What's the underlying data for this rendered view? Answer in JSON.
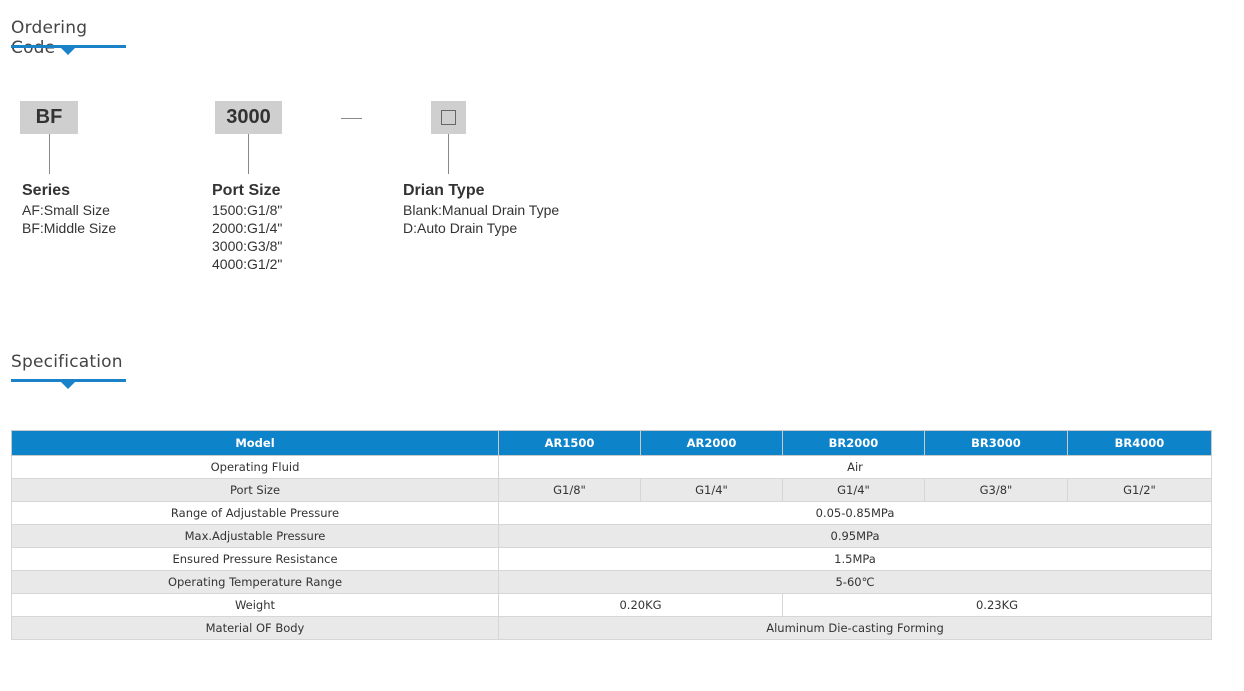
{
  "ordering": {
    "heading": "Ordering Code",
    "codes": {
      "series": "BF",
      "port": "3000",
      "drain_box": ""
    },
    "groups": {
      "series": {
        "title": "Series",
        "items": [
          "AF:Small Size",
          "BF:Middle Size"
        ]
      },
      "port": {
        "title": "Port Size",
        "items": [
          "1500:G1/8\"",
          "2000:G1/4\"",
          "3000:G3/8\"",
          "4000:G1/2\""
        ]
      },
      "drain": {
        "title": "Drian Type",
        "items": [
          "Blank:Manual Drain Type",
          "D:Auto Drain Type"
        ]
      }
    }
  },
  "specification": {
    "heading": "Specification",
    "columns": [
      "Model",
      "AR1500",
      "AR2000",
      "BR2000",
      "BR3000",
      "BR4000"
    ],
    "rows": {
      "fluid": {
        "label": "Operating Fluid",
        "value": "Air"
      },
      "port": {
        "label": "Port Size",
        "values": [
          "G1/8\"",
          "G1/4\"",
          "G1/4\"",
          "G3/8\"",
          "G1/2\""
        ]
      },
      "range": {
        "label": "Range of Adjustable Pressure",
        "value": "0.05-0.85MPa"
      },
      "max": {
        "label": "Max.Adjustable Pressure",
        "value": "0.95MPa"
      },
      "ensured": {
        "label": "Ensured Pressure Resistance",
        "value": "1.5MPa"
      },
      "temp": {
        "label": "Operating Temperature Range",
        "value": "5-60℃"
      },
      "weight": {
        "label": "Weight",
        "values": [
          "0.20KG",
          "0.23KG"
        ]
      },
      "material": {
        "label": "Material OF Body",
        "value": "Aluminum Die-casting Forming"
      }
    }
  }
}
